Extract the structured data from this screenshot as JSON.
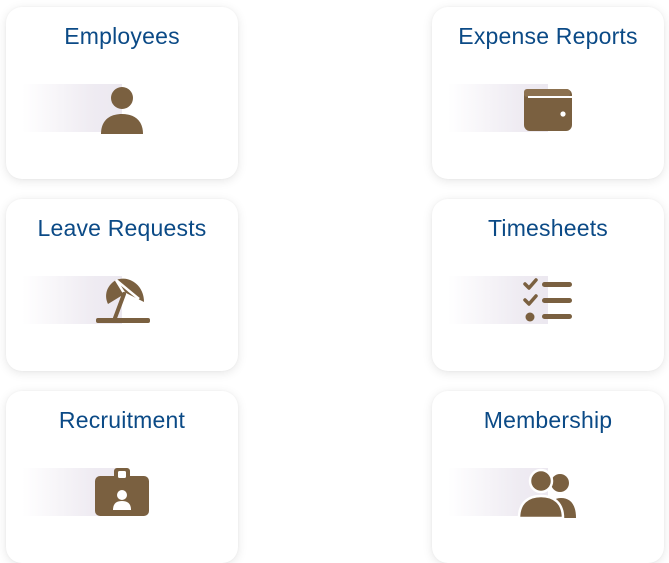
{
  "colors": {
    "title": "#0b4a86",
    "icon": "#7a6040",
    "card_bg": "#ffffff"
  },
  "cards": [
    {
      "label": "Employees",
      "icon": "person-icon"
    },
    {
      "label": "Expense Reports",
      "icon": "wallet-icon"
    },
    {
      "label": "Leave Requests",
      "icon": "beach-umbrella-icon"
    },
    {
      "label": "Timesheets",
      "icon": "checklist-icon"
    },
    {
      "label": "Recruitment",
      "icon": "id-badge-icon"
    },
    {
      "label": "Membership",
      "icon": "users-icon"
    }
  ]
}
